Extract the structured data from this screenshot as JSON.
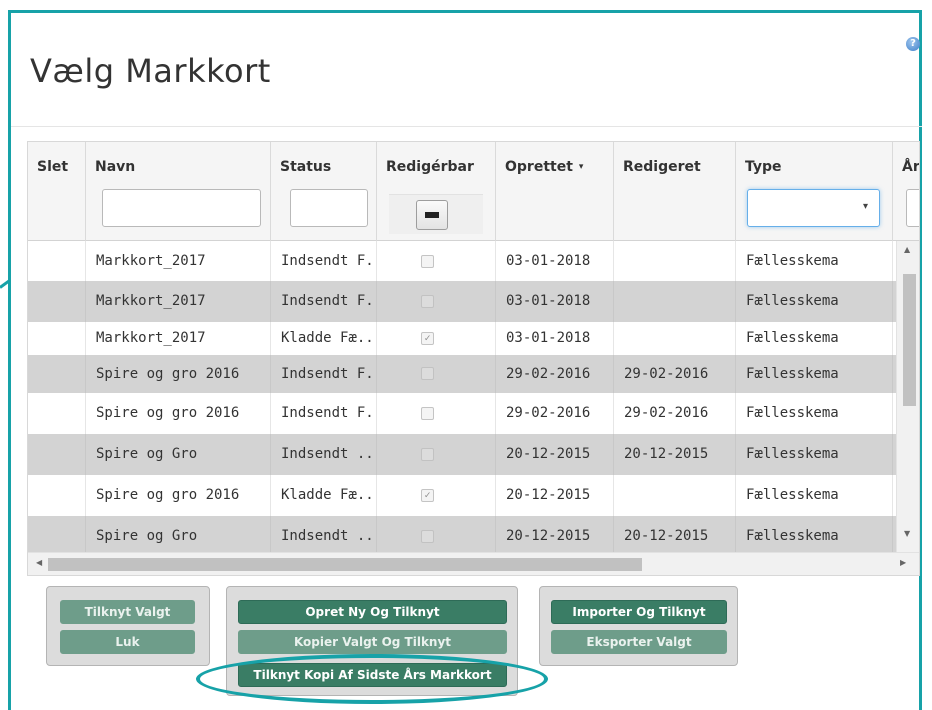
{
  "dialog": {
    "title": "Vælg Markkort",
    "help_icon": "help-icon"
  },
  "columns": {
    "slet": "Slet",
    "navn": "Navn",
    "status": "Status",
    "redigerbar": "Redigérbar",
    "oprettet": "Oprettet",
    "oprettet_sort": "▾",
    "redigeret": "Redigeret",
    "type": "Type",
    "aar": "År",
    "type_caret": "▾"
  },
  "rows": [
    {
      "navn": "Markkort_2017",
      "status": "Indsendt F...",
      "redigerbar": false,
      "oprettet": "03-01-2018",
      "redigeret": "",
      "type": "Fællesskema"
    },
    {
      "navn": "Markkort_2017",
      "status": "Indsendt F...",
      "redigerbar": false,
      "oprettet": "03-01-2018",
      "redigeret": "",
      "type": "Fællesskema"
    },
    {
      "navn": "Markkort_2017",
      "status": "Kladde Fæ...",
      "redigerbar": true,
      "oprettet": "03-01-2018",
      "redigeret": "",
      "type": "Fællesskema"
    },
    {
      "navn": "Spire og gro 2016",
      "status": "Indsendt F...",
      "redigerbar": false,
      "oprettet": "29-02-2016",
      "redigeret": "29-02-2016",
      "type": "Fællesskema"
    },
    {
      "navn": "Spire og gro 2016",
      "status": "Indsendt F...",
      "redigerbar": false,
      "oprettet": "29-02-2016",
      "redigeret": "29-02-2016",
      "type": "Fællesskema"
    },
    {
      "navn": "Spire og Gro",
      "status": "Indsendt ...",
      "redigerbar": false,
      "oprettet": "20-12-2015",
      "redigeret": "20-12-2015",
      "type": "Fællesskema"
    },
    {
      "navn": "Spire og gro 2016",
      "status": "Kladde Fæ...",
      "redigerbar": true,
      "oprettet": "20-12-2015",
      "redigeret": "",
      "type": "Fællesskema"
    },
    {
      "navn": "Spire og Gro",
      "status": "Indsendt ...",
      "redigerbar": false,
      "oprettet": "20-12-2015",
      "redigeret": "20-12-2015",
      "type": "Fællesskema"
    }
  ],
  "checkmark": "✓",
  "buttons": {
    "tilknyt_valgt": "Tilknyt Valgt",
    "luk": "Luk",
    "opret_ny": "Opret Ny Og Tilknyt",
    "kopier_valgt": "Kopier Valgt Og Tilknyt",
    "tilknyt_kopi": "Tilknyt Kopi Af Sidste Års Markkort",
    "importer": "Importer Og Tilknyt",
    "eksporter": "Eksporter Valgt"
  },
  "colors": {
    "accent": "#17a2a8",
    "button": "#3a7d65",
    "button_disabled": "#6e9d8a",
    "row_alt": "#d3d3d3"
  }
}
